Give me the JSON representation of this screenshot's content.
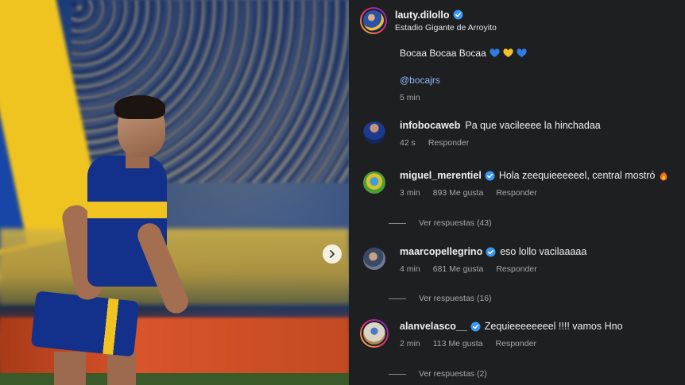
{
  "post": {
    "username": "lauty.dilollo",
    "location": "Estadio Gigante de Arroyito",
    "caption_text": "Bocaa Bocaa Bocaa",
    "caption_emojis": [
      "blue-heart",
      "yellow-heart",
      "blue-heart"
    ],
    "mention": "@bocajrs",
    "time": "5 min"
  },
  "comments": [
    {
      "username": "infobocaweb",
      "verified": false,
      "text": "Pa que vacileeee la hinchadaa",
      "time": "42 s",
      "likes": "",
      "reply_label": "Responder",
      "replies_label": ""
    },
    {
      "username": "miguel_merentiel",
      "verified": true,
      "text": "Hola zeequieeeeeel, central mostró",
      "time": "3 min",
      "likes": "893 Me gusta",
      "reply_label": "Responder",
      "replies_label": "Ver respuestas (43)"
    },
    {
      "username": "maarcopellegrino",
      "verified": true,
      "text": "eso lollo vacilaaaaa",
      "time": "4 min",
      "likes": "681 Me gusta",
      "reply_label": "Responder",
      "replies_label": "Ver respuestas (16)"
    },
    {
      "username": "alanvelasco__",
      "verified": true,
      "text": "Zequieeeeeeeel !!!! vamos Hno",
      "time": "2 min",
      "likes": "113 Me gusta",
      "reply_label": "Responder",
      "replies_label": "Ver respuestas (2)"
    }
  ],
  "colors": {
    "panel_bg": "#1e1f21",
    "verified_blue": "#3897f0",
    "mention_blue": "#8fb6ff",
    "meta_gray": "#a8a8a8"
  },
  "icons": {
    "next": "chevron-right-icon",
    "verified": "verified-badge-icon",
    "fire": "fire-icon"
  }
}
